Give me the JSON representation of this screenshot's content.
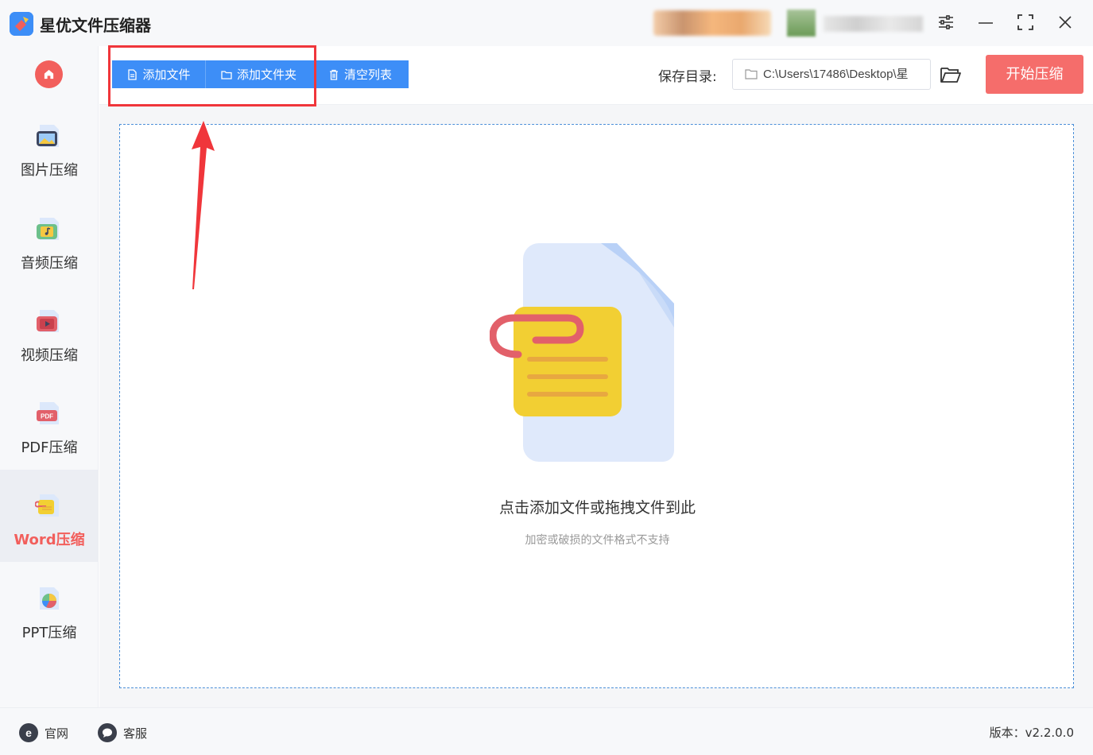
{
  "app": {
    "title": "星优文件压缩器"
  },
  "sidebar": {
    "items": [
      {
        "label": "图片压缩"
      },
      {
        "label": "音频压缩"
      },
      {
        "label": "视频压缩"
      },
      {
        "label": "PDF压缩"
      },
      {
        "label": "Word压缩"
      },
      {
        "label": "PPT压缩"
      }
    ],
    "active_index": 4
  },
  "toolbar": {
    "add_file": "添加文件",
    "add_folder": "添加文件夹",
    "clear_list": "清空列表",
    "save_label": "保存目录:",
    "save_path": "C:\\Users\\17486\\Desktop\\星",
    "start": "开始压缩"
  },
  "dropzone": {
    "title": "点击添加文件或拖拽文件到此",
    "subtitle": "加密或破损的文件格式不支持"
  },
  "footer": {
    "website": "官网",
    "support": "客服",
    "version": "版本：v2.2.0.0"
  },
  "colors": {
    "accent_blue": "#3d8ef7",
    "accent_red": "#f56d6b",
    "annotation_red": "#f0363b"
  }
}
